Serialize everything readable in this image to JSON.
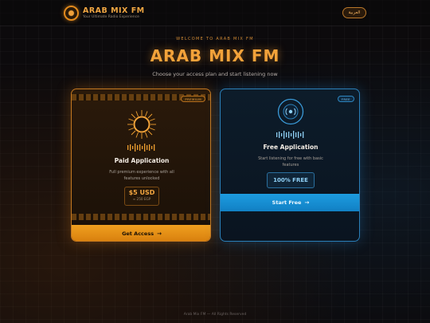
{
  "header": {
    "brand_name": "ARAB MIX FM",
    "brand_tagline": "Your Ultimate Radio Experience",
    "lang_button": "العربية"
  },
  "hero": {
    "kicker": "WELCOME TO ARAB MIX FM",
    "title": "ARAB MIX FM",
    "subtitle": "Choose your access plan and start listening now"
  },
  "plans": {
    "paid": {
      "badge": "PREMIUM",
      "title": "Paid Application",
      "description": "Full premium experience with all features unlocked",
      "price": "$5 USD",
      "price_alt": "≈ 250 EGP",
      "cta": "Get Access",
      "accent": "#f0a020"
    },
    "free": {
      "badge": "FREE",
      "title": "Free Application",
      "description": "Start listening for free with basic features",
      "price": "100% FREE",
      "cta": "Start Free",
      "accent": "#1d9ce0"
    }
  },
  "icons": {
    "logo": "radio-logo-icon",
    "paid_hero": "sunburst-icon",
    "free_hero": "radio-wave-icon",
    "equalizer": "equalizer-icon",
    "arrow": "arrow-right-icon"
  },
  "footer": {
    "text": "Arab Mix FM — All Rights Reserved"
  }
}
